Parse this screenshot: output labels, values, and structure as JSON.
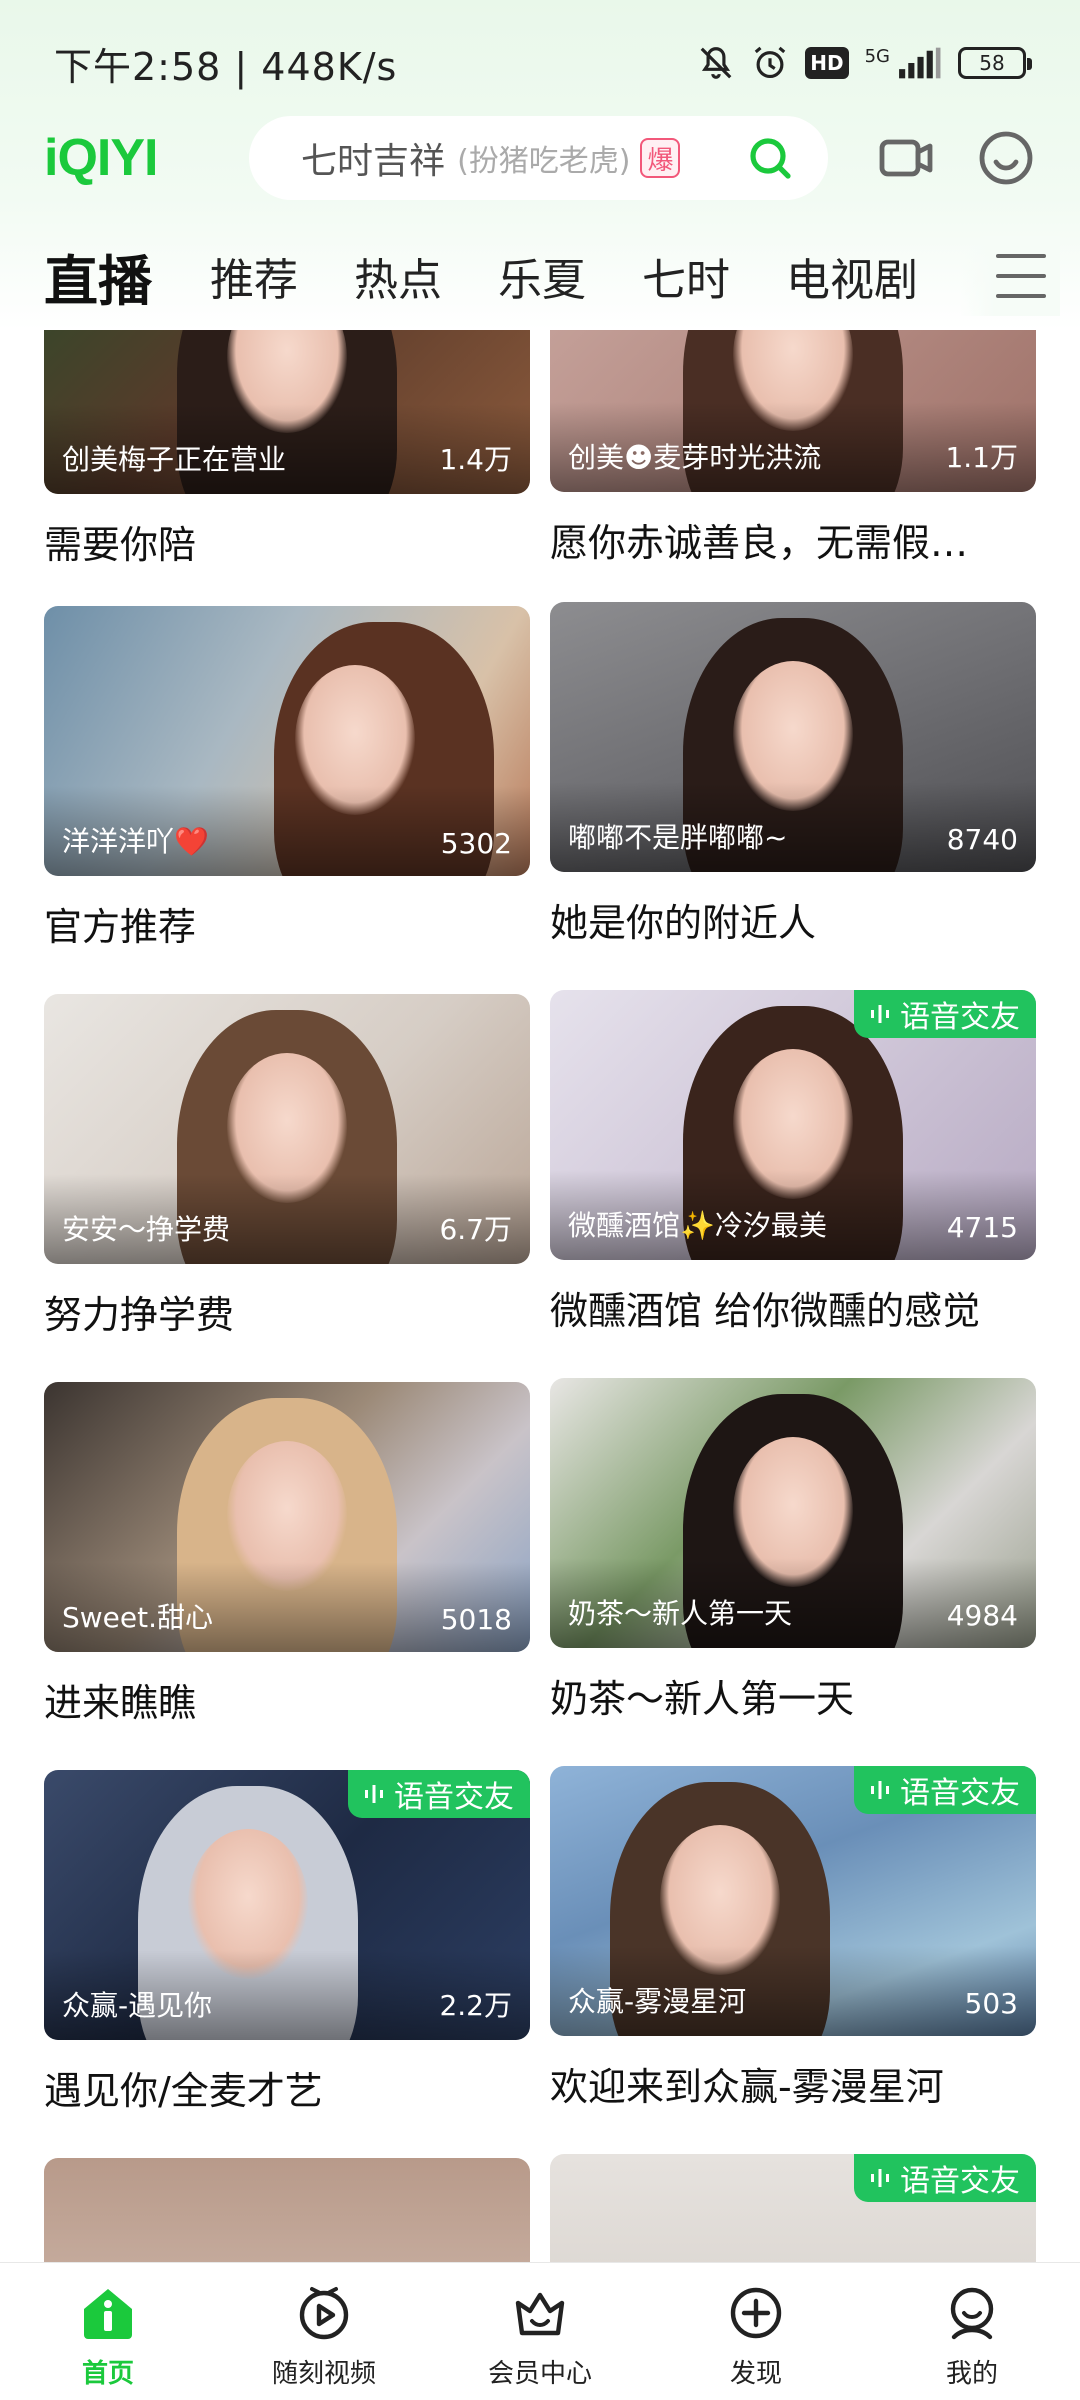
{
  "status_bar": {
    "time": "下午2:58 | 448K/s",
    "hd": "HD",
    "network": "5G",
    "battery": "58"
  },
  "header": {
    "logo": "iQIYI",
    "search": {
      "main": "七时吉祥",
      "sub": "(扮猪吃老虎)",
      "badge": "爆"
    }
  },
  "tabs": [
    {
      "label": "直播",
      "active": true
    },
    {
      "label": "推荐"
    },
    {
      "label": "热点"
    },
    {
      "label": "乐夏"
    },
    {
      "label": "七时"
    },
    {
      "label": "电视剧"
    }
  ],
  "feed": {
    "cards": [
      {
        "host": "创美梅子正在营业",
        "viewers": "1.4万",
        "title": "需要你陪",
        "voice": ""
      },
      {
        "host": "创美☻麦芽时光洪流",
        "viewers": "1.1万",
        "title": "愿你赤诚善良，无需假…",
        "voice": ""
      },
      {
        "host": "洋洋洋吖❤️",
        "viewers": "5302",
        "title": "官方推荐",
        "voice": ""
      },
      {
        "host": "嘟嘟不是胖嘟嘟~",
        "viewers": "8740",
        "title": "她是你的附近人",
        "voice": ""
      },
      {
        "host": "安安～挣学费",
        "viewers": "6.7万",
        "title": "努力挣学费",
        "voice": ""
      },
      {
        "host": "微醺酒馆✨冷汐最美",
        "viewers": "4715",
        "title": "微醺酒馆 给你微醺的感觉",
        "voice": "语音交友"
      },
      {
        "host": "Sweet.甜心",
        "viewers": "5018",
        "title": "进来瞧瞧",
        "voice": ""
      },
      {
        "host": "奶茶～新人第一天",
        "viewers": "4984",
        "title": "奶茶～新人第一天",
        "voice": ""
      },
      {
        "host": "众赢-遇见你",
        "viewers": "2.2万",
        "title": "遇见你/全麦才艺",
        "voice": "语音交友"
      },
      {
        "host": "众赢-雾漫星河",
        "viewers": "503",
        "title": "欢迎来到众赢-雾漫星河",
        "voice": "语音交友"
      },
      {
        "host": "",
        "viewers": "",
        "title": "",
        "voice": ""
      },
      {
        "host": "",
        "viewers": "",
        "title": "",
        "voice": "语音交友"
      }
    ]
  },
  "bottom_nav": [
    {
      "label": "首页",
      "icon": "home-icon",
      "active": true
    },
    {
      "label": "随刻视频",
      "icon": "play-icon"
    },
    {
      "label": "会员中心",
      "icon": "crown-icon"
    },
    {
      "label": "发现",
      "icon": "plus-circle-icon"
    },
    {
      "label": "我的",
      "icon": "profile-icon"
    }
  ],
  "colors": {
    "brand": "#1bc93c",
    "voice_badge": "#21c35e",
    "hot": "#f2587a"
  }
}
